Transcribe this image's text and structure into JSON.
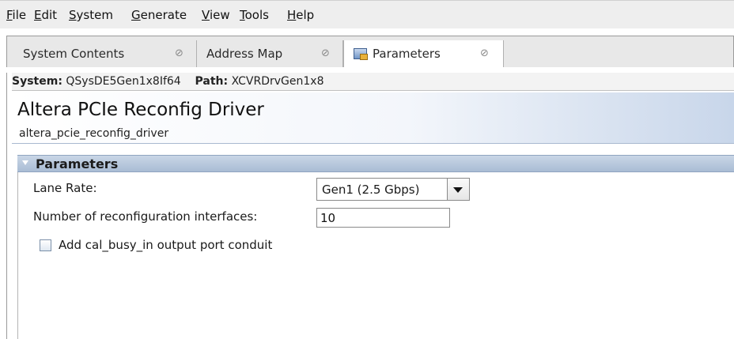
{
  "menubar": {
    "items": [
      {
        "mnemonic": "F",
        "rest": "ile"
      },
      {
        "mnemonic": "E",
        "rest": "dit"
      },
      {
        "mnemonic": "S",
        "rest": "ystem"
      },
      {
        "mnemonic": "G",
        "rest": "enerate"
      },
      {
        "mnemonic": "V",
        "rest": "iew"
      },
      {
        "mnemonic": "T",
        "rest": "ools"
      },
      {
        "mnemonic": "H",
        "rest": "elp"
      }
    ]
  },
  "tabs": [
    {
      "label": "System Contents",
      "close": "⊘",
      "active": false
    },
    {
      "label": "Address Map",
      "close": "⊘",
      "active": false
    },
    {
      "label": "Parameters",
      "close": "⊘",
      "active": true,
      "icon": "parameters-icon"
    }
  ],
  "pathbar": {
    "system_label": "System:",
    "system_value": "QSysDE5Gen1x8If64",
    "path_label": "Path:",
    "path_value": "XCVRDrvGen1x8"
  },
  "component": {
    "title": "Altera PCIe Reconfig Driver",
    "name": "altera_pcie_reconfig_driver"
  },
  "parameters": {
    "group_title": "Parameters",
    "lane_rate_label": "Lane Rate:",
    "lane_rate_value": "Gen1 (2.5 Gbps)",
    "num_interfaces_label": "Number of reconfiguration interfaces:",
    "num_interfaces_value": "10",
    "cal_busy_label": "Add cal_busy_in output port conduit",
    "cal_busy_checked": false
  }
}
